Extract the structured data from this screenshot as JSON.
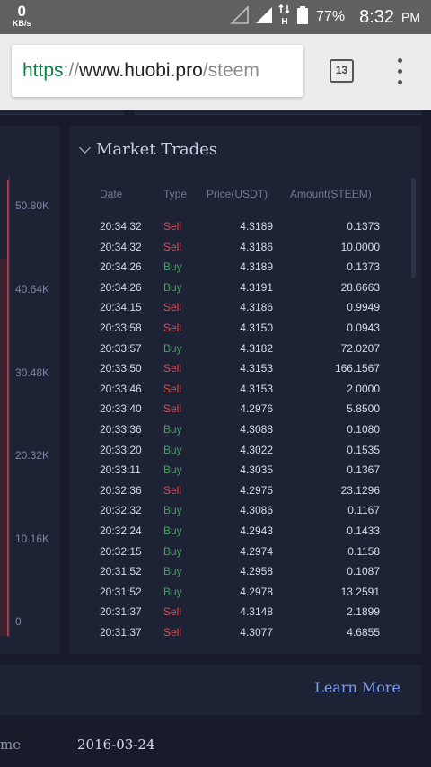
{
  "status_bar": {
    "net_speed": "0",
    "net_speed_unit": "KB/s",
    "signal_icon": "signal-icon",
    "data_icon": "data-transfer-icon",
    "data_letter": "H",
    "battery_icon": "battery-icon",
    "battery": "77%",
    "time": "8:32",
    "ampm": "PM"
  },
  "browser": {
    "url_scheme": "https",
    "url_sep": "://",
    "url_host": "www.huobi.pro",
    "url_path": "/steem",
    "tab_count": "13",
    "menu_icon": "more-vert-icon"
  },
  "depth_chart": {
    "axis_labels": [
      "50.80K",
      "40.64K",
      "30.48K",
      "20.32K",
      "10.16K",
      "0"
    ],
    "color_line": "#c03b4a"
  },
  "market_trades": {
    "title": "Market Trades",
    "columns": {
      "date": "Date",
      "type": "Type",
      "price": "Price(USDT)",
      "amount": "Amount(STEEM)"
    },
    "colors": {
      "sell": "#d64f55",
      "buy": "#44a362"
    },
    "rows": [
      {
        "date": "20:34:32",
        "type": "Sell",
        "price": "4.3189",
        "amount": "0.1373"
      },
      {
        "date": "20:34:32",
        "type": "Sell",
        "price": "4.3186",
        "amount": "10.0000"
      },
      {
        "date": "20:34:26",
        "type": "Buy",
        "price": "4.3189",
        "amount": "0.1373"
      },
      {
        "date": "20:34:26",
        "type": "Buy",
        "price": "4.3191",
        "amount": "28.6663"
      },
      {
        "date": "20:34:15",
        "type": "Sell",
        "price": "4.3186",
        "amount": "0.9949"
      },
      {
        "date": "20:33:58",
        "type": "Sell",
        "price": "4.3150",
        "amount": "0.0943"
      },
      {
        "date": "20:33:57",
        "type": "Buy",
        "price": "4.3182",
        "amount": "72.0207"
      },
      {
        "date": "20:33:50",
        "type": "Sell",
        "price": "4.3153",
        "amount": "166.1567"
      },
      {
        "date": "20:33:46",
        "type": "Sell",
        "price": "4.3153",
        "amount": "2.0000"
      },
      {
        "date": "20:33:40",
        "type": "Sell",
        "price": "4.2976",
        "amount": "5.8500"
      },
      {
        "date": "20:33:36",
        "type": "Buy",
        "price": "4.3088",
        "amount": "0.1080"
      },
      {
        "date": "20:33:20",
        "type": "Buy",
        "price": "4.3022",
        "amount": "0.1535"
      },
      {
        "date": "20:33:11",
        "type": "Buy",
        "price": "4.3035",
        "amount": "0.1367"
      },
      {
        "date": "20:32:36",
        "type": "Sell",
        "price": "4.2975",
        "amount": "23.1296"
      },
      {
        "date": "20:32:32",
        "type": "Buy",
        "price": "4.3086",
        "amount": "0.1167"
      },
      {
        "date": "20:32:24",
        "type": "Buy",
        "price": "4.2943",
        "amount": "0.1433"
      },
      {
        "date": "20:32:15",
        "type": "Buy",
        "price": "4.2974",
        "amount": "0.1158"
      },
      {
        "date": "20:31:52",
        "type": "Buy",
        "price": "4.2958",
        "amount": "0.1087"
      },
      {
        "date": "20:31:52",
        "type": "Buy",
        "price": "4.2978",
        "amount": "13.2591"
      },
      {
        "date": "20:31:37",
        "type": "Sell",
        "price": "4.3148",
        "amount": "2.1899"
      },
      {
        "date": "20:31:37",
        "type": "Sell",
        "price": "4.3077",
        "amount": "4.6855"
      }
    ]
  },
  "info": {
    "learn_more": "Learn More",
    "label": "me",
    "value": "2016-03-24"
  }
}
